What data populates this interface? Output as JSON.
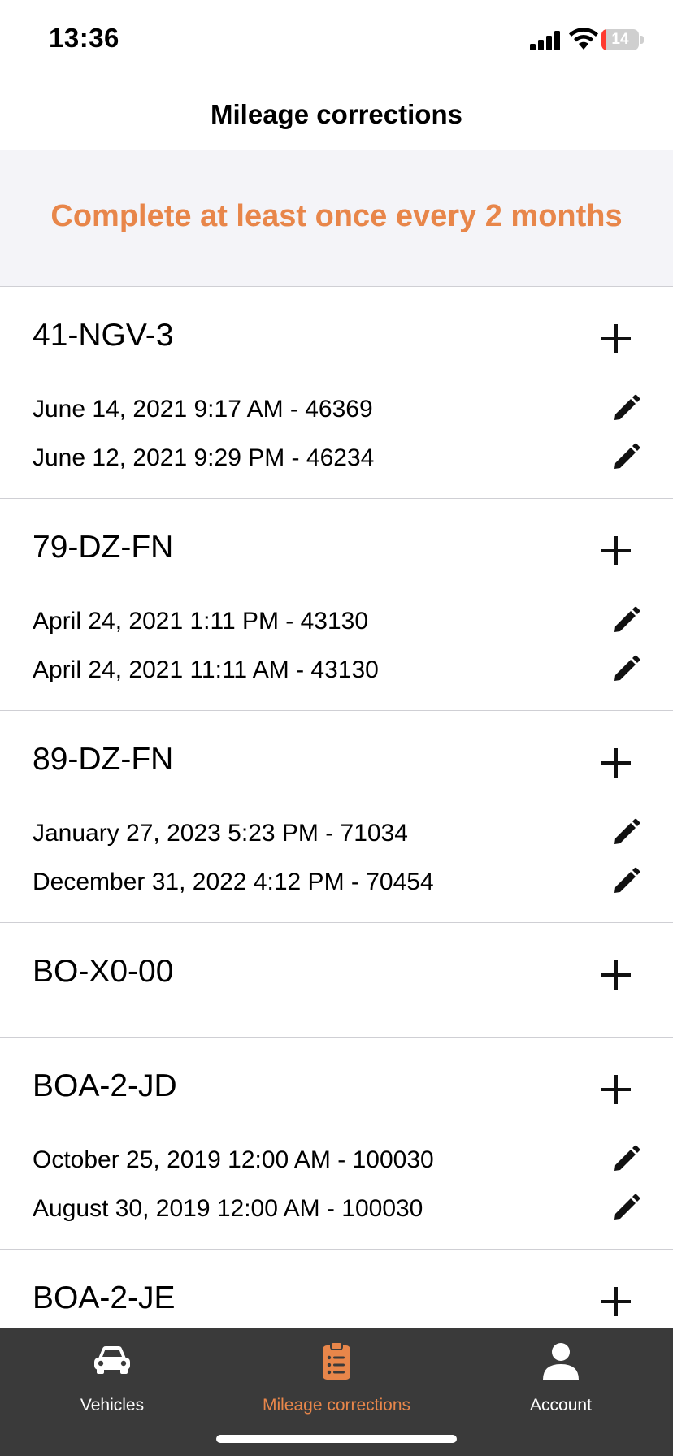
{
  "status_bar": {
    "time": "13:36",
    "battery_level": "14",
    "battery_color": "#ff3b30"
  },
  "nav": {
    "title": "Mileage corrections"
  },
  "banner": {
    "text": "Complete at least once every 2 months",
    "color": "#e8864a"
  },
  "vehicles": [
    {
      "plate": "41-NGV-3",
      "entries": [
        "June 14, 2021 9:17 AM - 46369",
        "June 12, 2021 9:29 PM - 46234"
      ]
    },
    {
      "plate": "79-DZ-FN",
      "entries": [
        "April 24, 2021 1:11 PM - 43130",
        "April 24, 2021 11:11 AM - 43130"
      ]
    },
    {
      "plate": "89-DZ-FN",
      "entries": [
        "January 27, 2023 5:23 PM - 71034",
        "December 31, 2022 4:12 PM - 70454"
      ]
    },
    {
      "plate": "BO-X0-00",
      "entries": []
    },
    {
      "plate": "BOA-2-JD",
      "entries": [
        "October 25, 2019 12:00 AM - 100030",
        "August 30, 2019 12:00 AM - 100030"
      ]
    },
    {
      "plate": "BOA-2-JE",
      "entries": []
    }
  ],
  "icons": {
    "add": "plus-icon",
    "edit": "pencil-icon"
  },
  "tab_bar": {
    "tabs": [
      {
        "label": "Vehicles",
        "icon": "car-icon",
        "active": false
      },
      {
        "label": "Mileage corrections",
        "icon": "clipboard-list-icon",
        "active": true
      },
      {
        "label": "Account",
        "icon": "person-icon",
        "active": false
      }
    ],
    "active_color": "#e8864a",
    "background": "#3a3a3a"
  }
}
